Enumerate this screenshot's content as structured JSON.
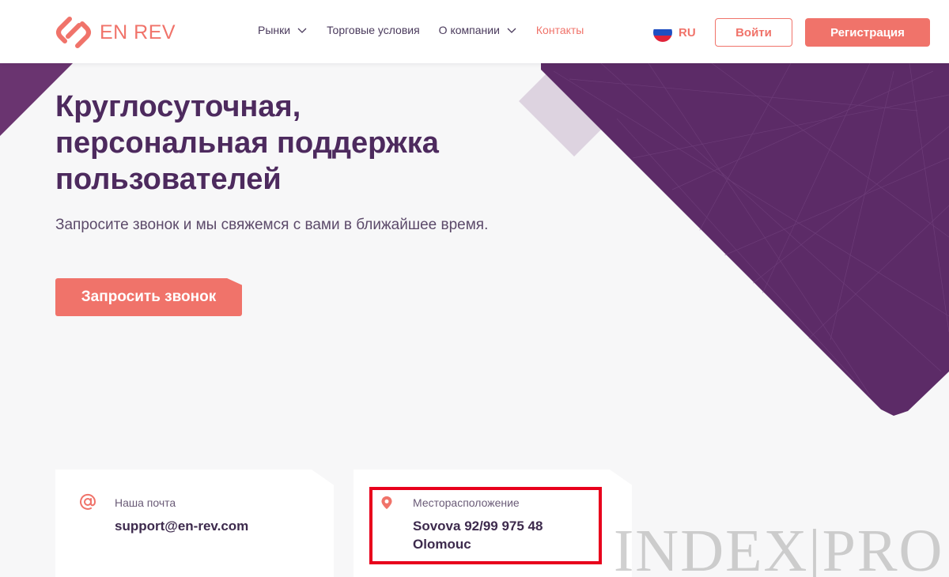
{
  "header": {
    "logo_text": "EN REV",
    "nav": [
      {
        "label": "Рынки",
        "has_dropdown": true
      },
      {
        "label": "Торговые условия",
        "has_dropdown": false
      },
      {
        "label": "О компании",
        "has_dropdown": true
      },
      {
        "label": "Контакты",
        "has_dropdown": false
      }
    ],
    "lang": "RU",
    "login_label": "Войти",
    "register_label": "Регистрация"
  },
  "hero": {
    "title": "Круглосуточная, персональная поддержка пользователей",
    "subtitle": "Запросите звонок и мы свяжемся с вами в ближайшее время.",
    "cta_label": "Запросить звонок"
  },
  "contacts": {
    "email": {
      "label": "Наша почта",
      "value": "support@en-rev.com",
      "icon": "at-icon"
    },
    "location": {
      "label": "Месторасположение",
      "line1": "Sovova 92/99 975 48",
      "line2": "Olomouc",
      "icon": "map-pin-icon"
    }
  },
  "watermark": "INDEX|PRO",
  "colors": {
    "accent": "#f0736a",
    "purple": "#5a2a68",
    "highlight": "#e8001c"
  }
}
